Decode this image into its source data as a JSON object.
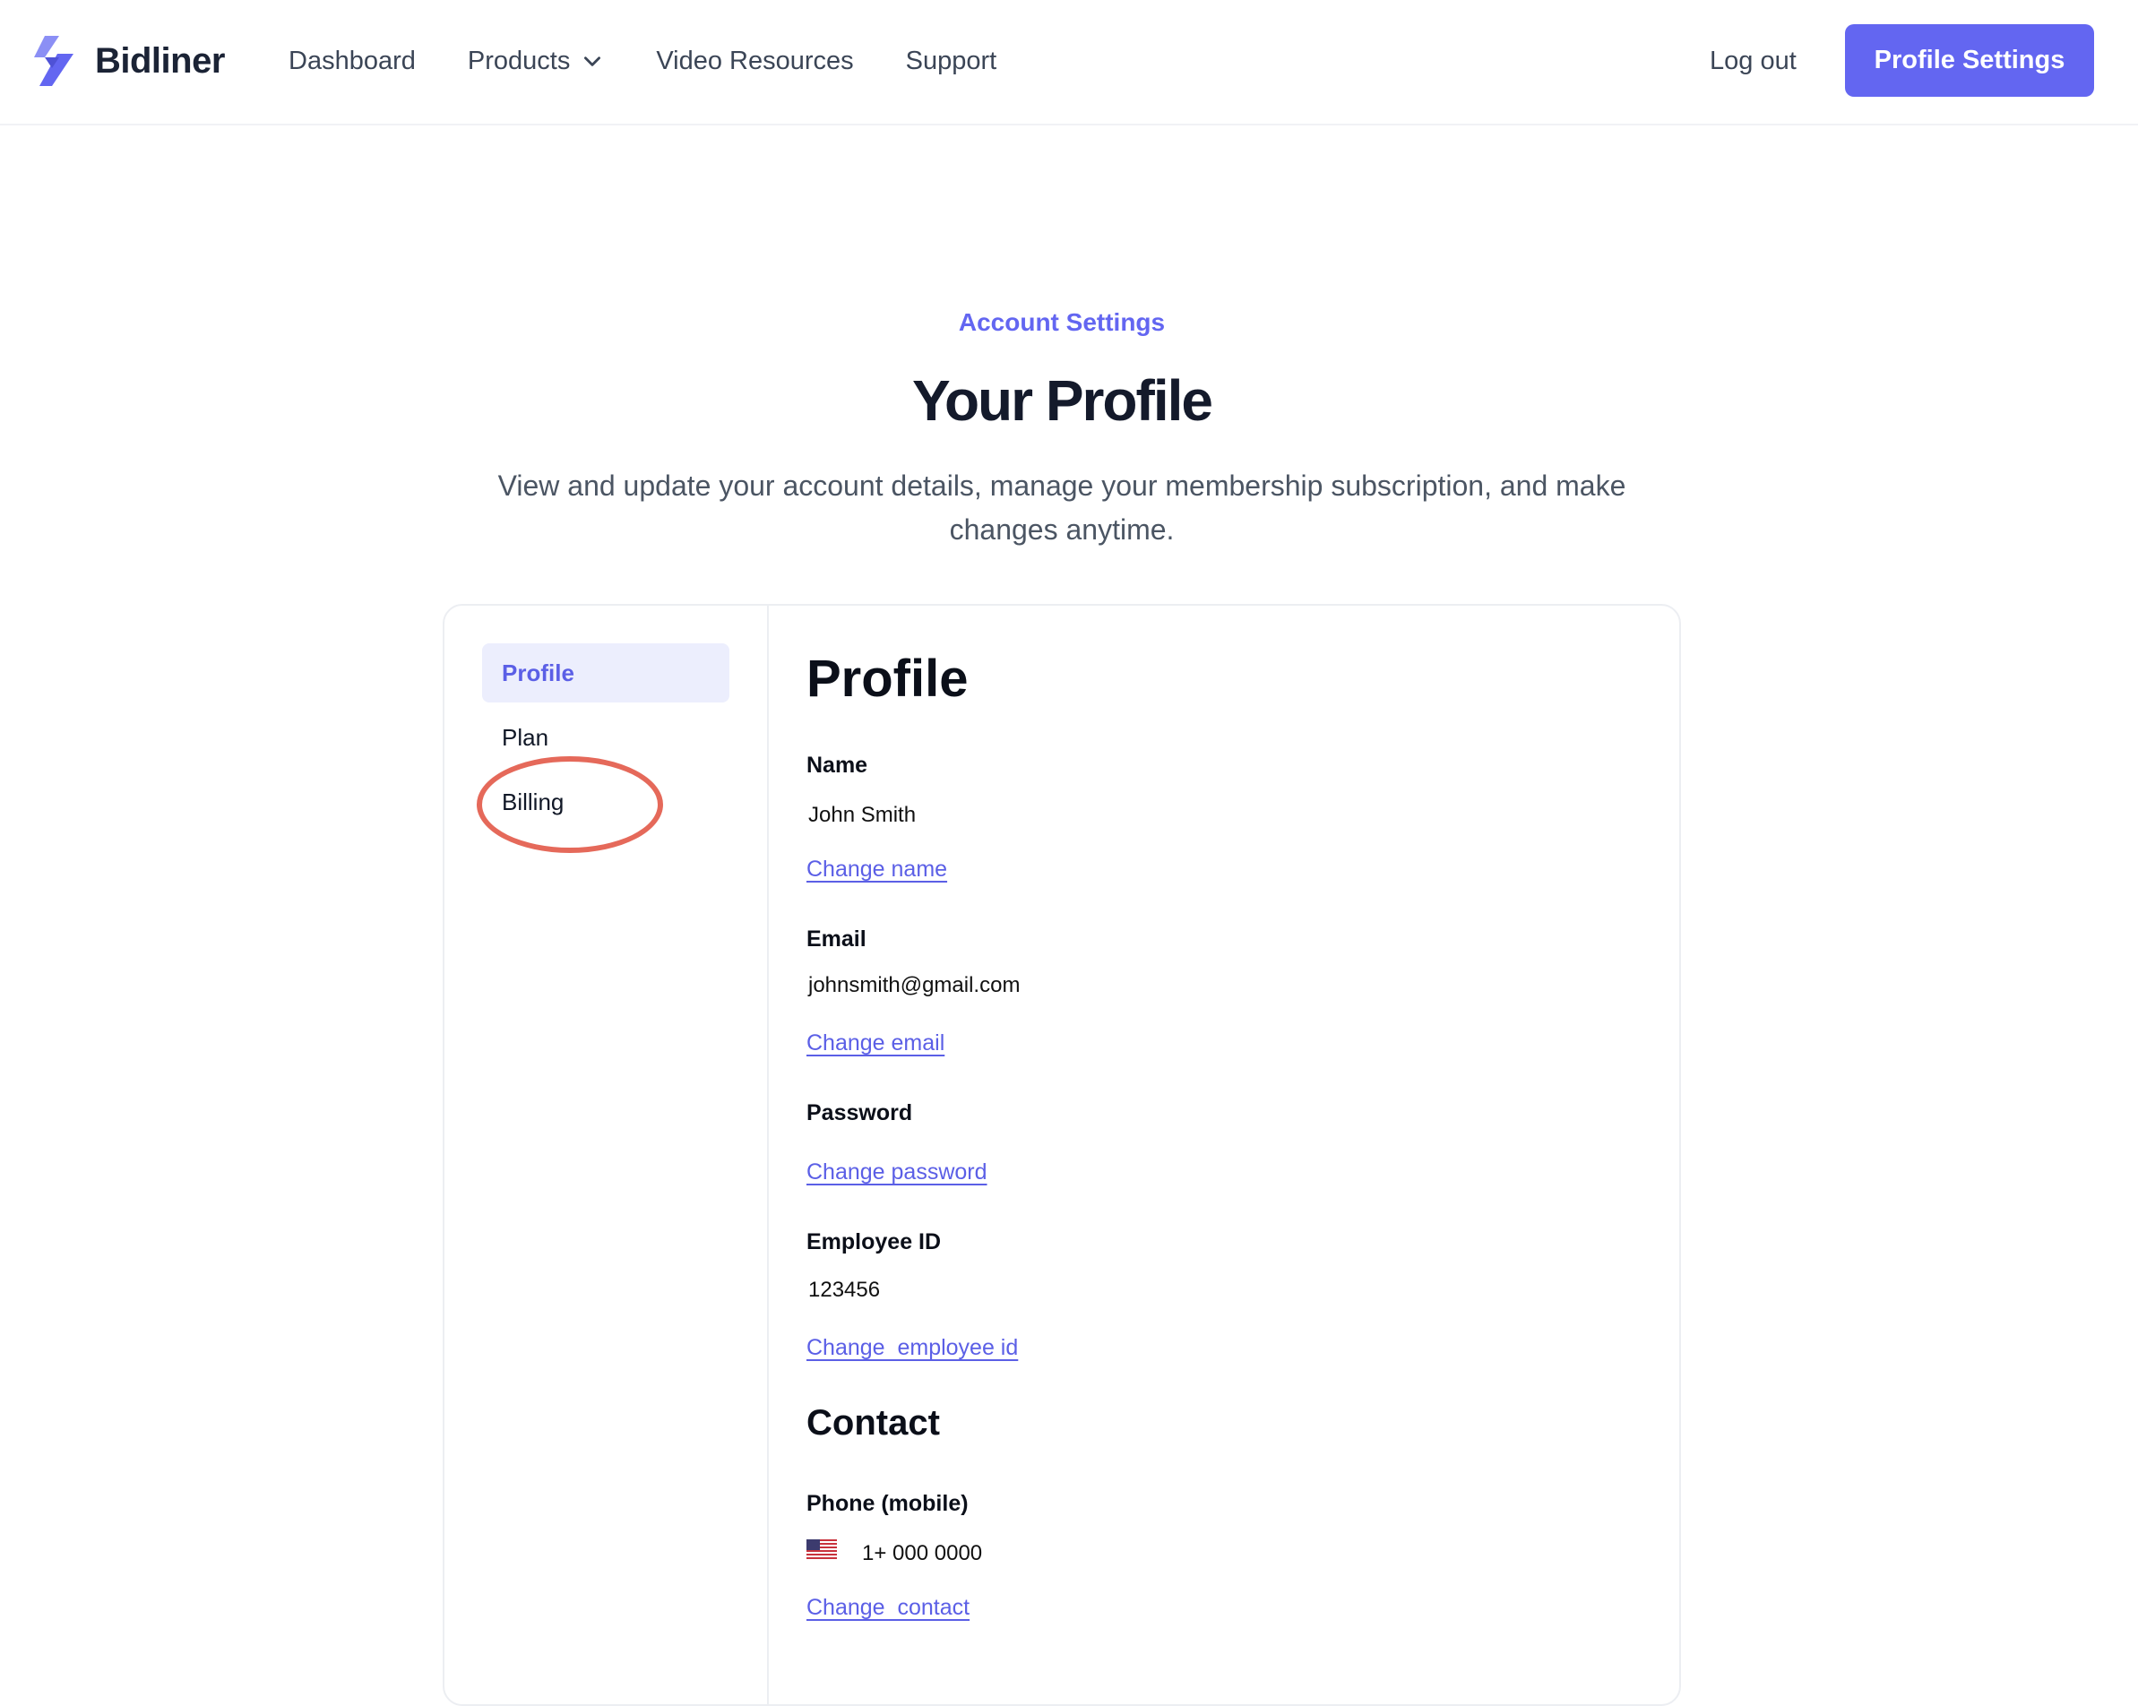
{
  "header": {
    "brand": "Bidliner",
    "brand_color": "#6366f1",
    "nav": {
      "dashboard": "Dashboard",
      "products": "Products",
      "video_resources": "Video Resources",
      "support": "Support"
    },
    "logout_label": "Log out",
    "profile_settings_label": "Profile Settings"
  },
  "hero": {
    "eyebrow": "Account Settings",
    "title": "Your Profile",
    "subtitle": "View and update your account details, manage your membership subscription, and make changes anytime."
  },
  "sidebar": {
    "items": [
      {
        "label": "Profile",
        "active": true
      },
      {
        "label": "Plan",
        "active": false
      },
      {
        "label": "Billing",
        "active": false,
        "annotated": true
      }
    ],
    "annotation_color": "#e5695a"
  },
  "profile": {
    "heading": "Profile",
    "name": {
      "label": "Name",
      "value": "John Smith",
      "action": "Change name"
    },
    "email": {
      "label": "Email",
      "value": "johnsmith@gmail.com",
      "action": "Change email"
    },
    "password": {
      "label": "Password",
      "action": "Change password"
    },
    "employee_id": {
      "label": "Employee ID",
      "value": "123456",
      "action": "Change  employee id"
    }
  },
  "contact": {
    "heading": "Contact",
    "phone": {
      "label": "Phone (mobile)",
      "flag_icon": "us-flag-icon",
      "value": "1+ 000 0000",
      "action": "Change  contact"
    }
  }
}
